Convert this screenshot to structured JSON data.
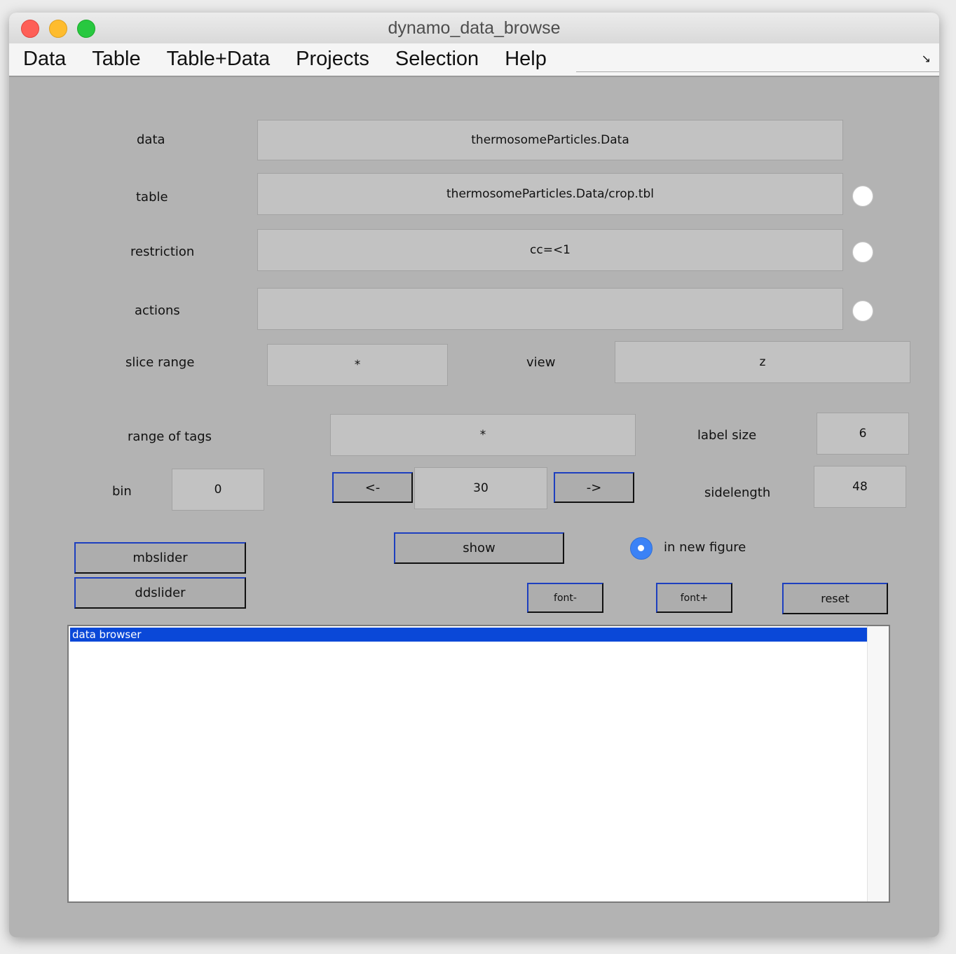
{
  "window": {
    "title": "dynamo_data_browse"
  },
  "menu": [
    "Data",
    "Table",
    "Table+Data",
    "Projects",
    "Selection",
    "Help"
  ],
  "menu_corner": "↘",
  "form": {
    "data_label": "data",
    "data_value": "thermosomeParticles.Data",
    "table_label": "table",
    "table_value": "thermosomeParticles.Data/crop.tbl",
    "restriction_label": "restriction",
    "restriction_value": "cc=<1",
    "actions_label": "actions",
    "actions_value": "",
    "slice_range_label": "slice range",
    "slice_range_value": "*",
    "view_label": "view",
    "view_value": "z",
    "range_of_tags_label": "range of tags",
    "range_of_tags_value": "*",
    "label_size_label": "label size",
    "label_size_value": "6",
    "bin_label": "bin",
    "bin_value": "0",
    "index_value": "30",
    "sidelength_label": "sidelength",
    "sidelength_value": "48",
    "in_new_figure_label": "in new figure",
    "in_new_figure_checked": true
  },
  "buttons": {
    "prev": "<-",
    "next": "->",
    "mbslider": "mbslider",
    "ddslider": "ddslider",
    "show": "show",
    "font_minus": "font-",
    "font_plus": "font+",
    "reset": "reset"
  },
  "listbox": {
    "items": [
      "data browser"
    ],
    "selected_index": 0
  },
  "colors": {
    "selection": "#0a48d8",
    "radio_on": "#3b82f6",
    "background": "#b3b3b3"
  }
}
